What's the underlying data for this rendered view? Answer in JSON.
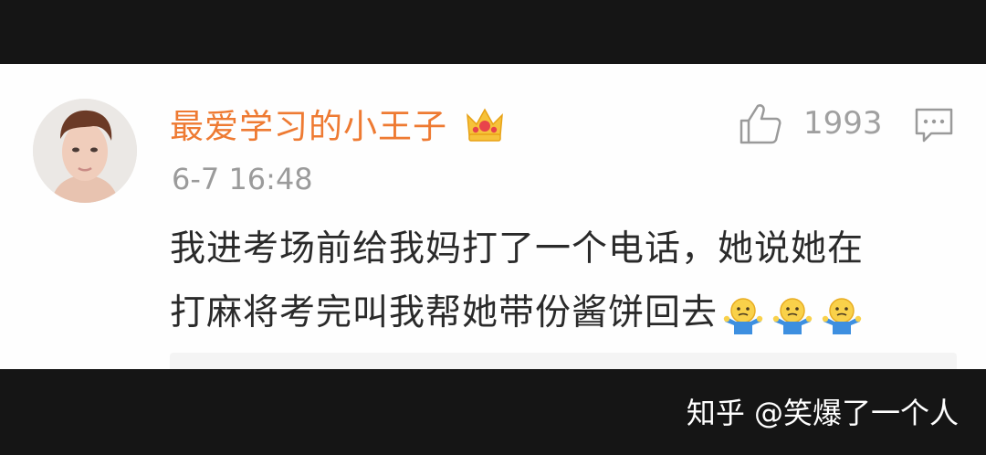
{
  "comment": {
    "username": "最爱学习的小王子",
    "timestamp": "6-7 16:48",
    "like_count": "1993",
    "text_lines": [
      "我进考场前给我妈打了一个电话，她说她在",
      "打麻将考完叫我帮她带份酱饼回去"
    ],
    "badge_icon": "crown-badge-icon",
    "emojis": [
      "shrug-emoji",
      "shrug-emoji",
      "shrug-emoji"
    ]
  },
  "watermark": "知乎 @笑爆了一个人",
  "colors": {
    "username": "#ee7a32",
    "meta": "#9b9b9b",
    "background_bars": "#151515"
  }
}
